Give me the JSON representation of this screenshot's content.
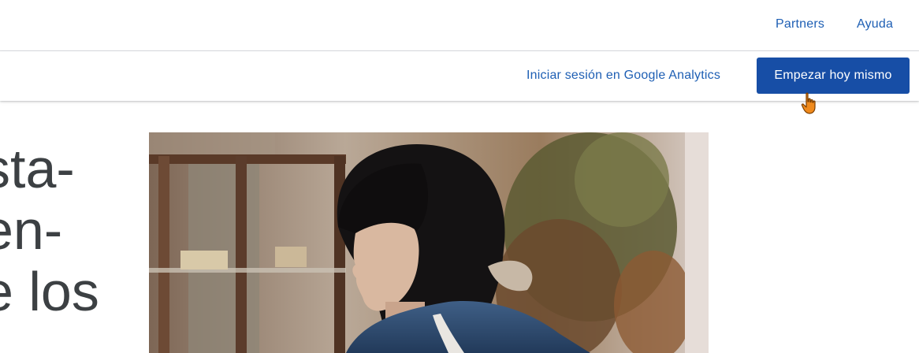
{
  "header": {
    "links": [
      {
        "label": "Partners"
      },
      {
        "label": "Ayuda"
      }
    ]
  },
  "subheader": {
    "signin_label": "Iniciar sesión en Google Analytics",
    "cta_label": "Empezar hoy mismo"
  },
  "hero": {
    "lines": [
      "sta-",
      "en-",
      "e los"
    ]
  },
  "colors": {
    "link": "#1e5fb4",
    "cta_background": "#174ea6",
    "heading": "#3c4043"
  }
}
